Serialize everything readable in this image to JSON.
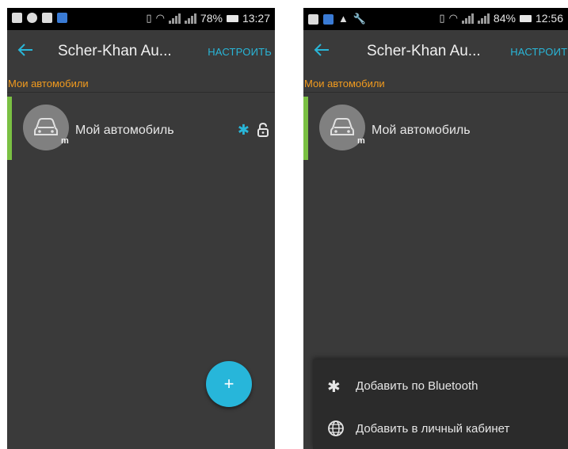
{
  "top_caption": {
    "left_text": "",
    "right_text": ""
  },
  "left_screen": {
    "statusbar": {
      "battery": "78%",
      "time": "13:27"
    },
    "appbar": {
      "title": "Scher-Khan Au...",
      "config_label": "НАСТРОИТЬ"
    },
    "section_label": "Мои автомобили",
    "car": {
      "name": "Мой автомобиль",
      "avatar_letter": "m"
    },
    "fab_label": "+"
  },
  "right_screen": {
    "statusbar": {
      "battery": "84%",
      "time": "12:56"
    },
    "appbar": {
      "title": "Scher-Khan Au...",
      "config_label": "НАСТРОИТЬ"
    },
    "section_label": "Мои автомобили",
    "car": {
      "name": "Мой автомобиль",
      "avatar_letter": "m"
    },
    "sheet": {
      "items": [
        {
          "label": "Добавить по Bluetooth",
          "icon": "bluetooth-icon"
        },
        {
          "label": "Добавить в личный кабинет",
          "icon": "globe-icon"
        }
      ]
    }
  },
  "colors": {
    "accent": "#29b6d8",
    "section": "#f29b1e",
    "car_accent": "#7ac043",
    "background": "#3a3a3a"
  }
}
